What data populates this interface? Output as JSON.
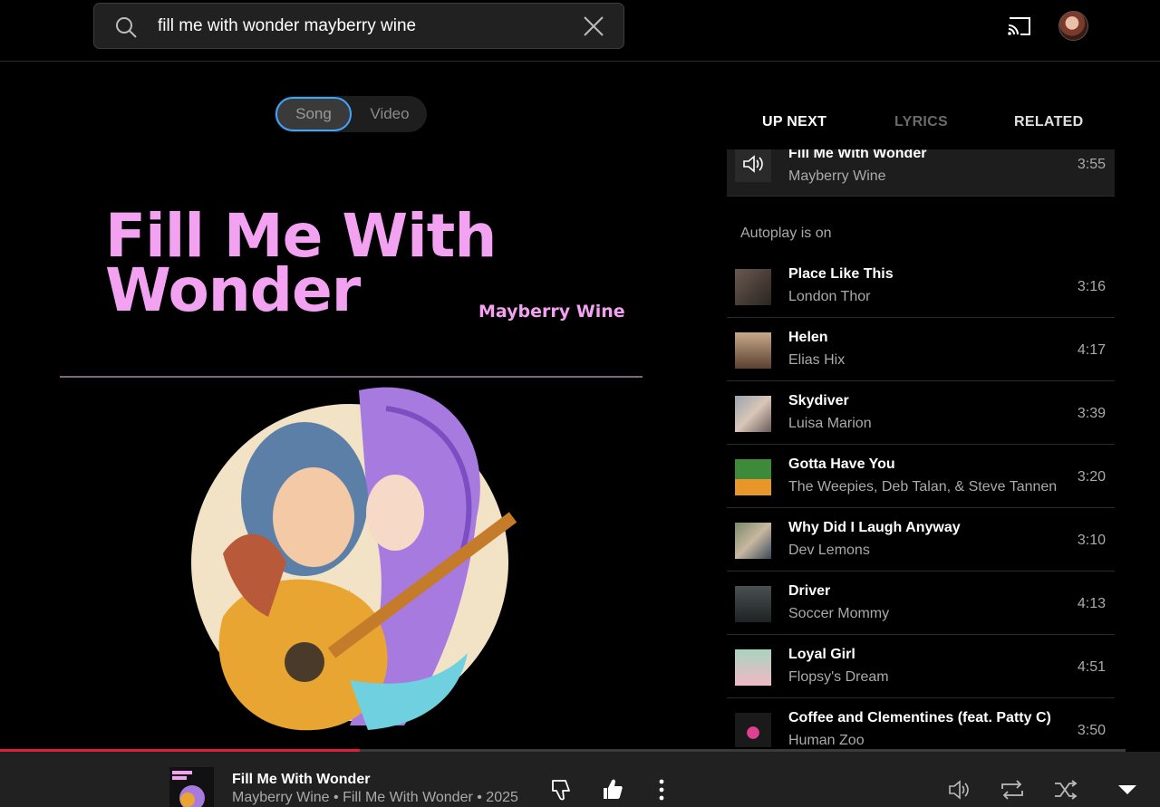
{
  "search": {
    "query": "fill me with wonder mayberry wine"
  },
  "toggle": {
    "song_label": "Song",
    "video_label": "Video"
  },
  "album_art": {
    "title_line1": "Fill Me With",
    "title_line2": "Wonder",
    "artist": "Mayberry Wine"
  },
  "tabs": {
    "up_next": "UP NEXT",
    "lyrics": "LYRICS",
    "related": "RELATED"
  },
  "queue": {
    "current": {
      "title": "Fill Me With Wonder",
      "artist": "Mayberry Wine",
      "duration": "3:55"
    },
    "autoplay_label": "Autoplay is on",
    "items": [
      {
        "title": "Place Like This",
        "artist": "London Thor",
        "duration": "3:16"
      },
      {
        "title": "Helen",
        "artist": "Elias Hix",
        "duration": "4:17"
      },
      {
        "title": "Skydiver",
        "artist": "Luisa Marion",
        "duration": "3:39"
      },
      {
        "title": "Gotta Have You",
        "artist": "The Weepies, Deb Talan, & Steve Tannen",
        "duration": "3:20"
      },
      {
        "title": "Why Did I Laugh Anyway",
        "artist": "Dev Lemons",
        "duration": "3:10"
      },
      {
        "title": "Driver",
        "artist": "Soccer Mommy",
        "duration": "4:13"
      },
      {
        "title": "Loyal Girl",
        "artist": "Flopsy's Dream",
        "duration": "4:51"
      },
      {
        "title": "Coffee and Clementines (feat. Patty C)",
        "artist": "Human Zoo",
        "duration": "3:50"
      }
    ]
  },
  "player": {
    "title": "Fill Me With Wonder",
    "subtitle": "Mayberry Wine • Fill Me With Wonder • 2025",
    "progress_fraction": 0.32
  },
  "colors": {
    "accent": "#3ea6ff",
    "progress": "#e01e3c",
    "title_pink": "#f2a2f0"
  },
  "icons": {
    "search": "search-icon",
    "clear": "close-icon",
    "cast": "cast-icon",
    "volume": "volume-icon",
    "dislike": "thumb-down-icon",
    "like": "thumb-up-icon",
    "more": "more-vert-icon",
    "repeat": "repeat-icon",
    "shuffle": "shuffle-icon",
    "expand": "caret-down-icon"
  }
}
